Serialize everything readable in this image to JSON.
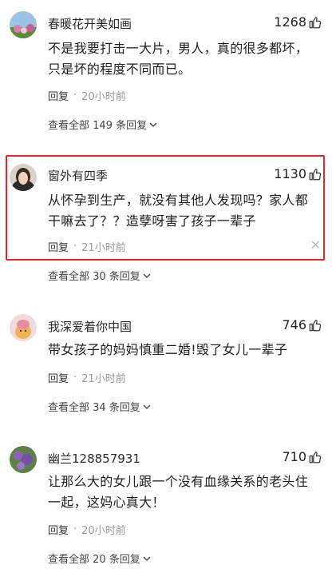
{
  "comments": [
    {
      "username": "春暖花开美如画",
      "likes": "1268",
      "text": "不是我要打击一大片，男人，真的很多都坏，只是坏的程度不同而已。",
      "reply_label": "回复",
      "time": "20小时前",
      "view_all": "查看全部 149 条回复"
    },
    {
      "username": "窗外有四季",
      "likes": "1130",
      "text": "从怀孕到生产，就没有其他人发现吗？家人都干嘛去了？？造孽呀害了孩子一辈子",
      "reply_label": "回复",
      "time": "21小时前",
      "view_all": "查看全部 30 条回复"
    },
    {
      "username": "我深爱着你中国",
      "likes": "746",
      "text": "带女孩子的妈妈慎重二婚!毁了女儿一辈子",
      "reply_label": "回复",
      "time": "21小时前",
      "view_all": "查看全部 34 条回复"
    },
    {
      "username": "幽兰128857931",
      "likes": "710",
      "text": "让那么大的女儿跟一个没有血缘关系的老头住一起，这妈心真大！",
      "reply_label": "回复",
      "time": "20小时前",
      "view_all": "查看全部 20 条回复"
    }
  ],
  "icons": {
    "like": "thumbs-up-icon",
    "close": "close-icon",
    "expand": "chevron-down-icon"
  },
  "colors": {
    "highlight_border": "#e8252b",
    "muted_text": "#999999"
  }
}
